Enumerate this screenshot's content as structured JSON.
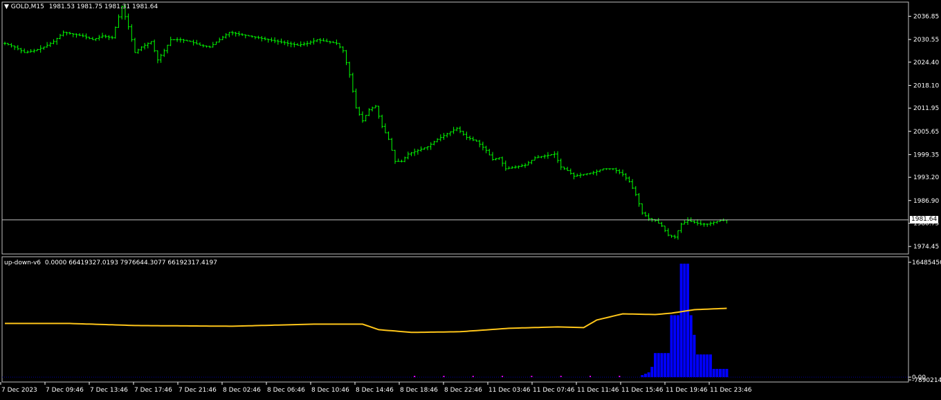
{
  "main_header": {
    "symbol": "GOLD,M15",
    "ohlc": "1981.53 1981.75 1981.31 1981.64"
  },
  "indicator_header": {
    "name": "up-down-v6",
    "values": "0.0000 66419327.0193 7976644.3077 66192317.4197"
  },
  "current_price_label": "1981.64",
  "colors": {
    "background": "#000000",
    "axis": "#ffffff",
    "bars": "#00ff00",
    "price_line": "#c0c0c0",
    "histogram": "#0000ff",
    "signal_line": "#ffc61a",
    "small_marks": "#ff00ff"
  },
  "chart_data": [
    {
      "type": "bar",
      "name": "GOLD,M15 price chart",
      "y_ticks": [
        "2036.85",
        "2030.55",
        "2024.40",
        "2018.10",
        "2011.95",
        "2005.65",
        "1999.35",
        "1993.20",
        "1986.90",
        "1980.75",
        "1974.45"
      ],
      "ylim": [
        1972.6,
        2040.5
      ],
      "current_price": 1981.64,
      "x_labels": [
        "7 Dec 2023",
        "7 Dec 09:46",
        "7 Dec 13:46",
        "7 Dec 17:46",
        "7 Dec 21:46",
        "8 Dec 02:46",
        "8 Dec 06:46",
        "8 Dec 10:46",
        "8 Dec 14:46",
        "8 Dec 18:46",
        "8 Dec 22:46",
        "11 Dec 03:46",
        "11 Dec 07:46",
        "11 Dec 11:46",
        "11 Dec 15:46",
        "11 Dec 19:46",
        "11 Dec 23:46"
      ],
      "close_path": [
        [
          0,
          2029.5
        ],
        [
          3,
          2028.5
        ],
        [
          6,
          2027.0
        ],
        [
          9,
          2027.5
        ],
        [
          12,
          2028.5
        ],
        [
          15,
          2030.0
        ],
        [
          18,
          2032.5
        ],
        [
          21,
          2032.0
        ],
        [
          24,
          2031.5
        ],
        [
          27,
          2030.5
        ],
        [
          30,
          2031.5
        ],
        [
          33,
          2031.0
        ],
        [
          36,
          2039.5
        ],
        [
          38,
          2034.0
        ],
        [
          40,
          2027.0
        ],
        [
          42,
          2028.5
        ],
        [
          45,
          2030.0
        ],
        [
          47,
          2025.0
        ],
        [
          49,
          2027.5
        ],
        [
          51,
          2030.5
        ],
        [
          54,
          2030.5
        ],
        [
          57,
          2030.0
        ],
        [
          60,
          2029.0
        ],
        [
          63,
          2028.5
        ],
        [
          66,
          2030.5
        ],
        [
          69,
          2032.5
        ],
        [
          72,
          2032.0
        ],
        [
          75,
          2031.5
        ],
        [
          78,
          2031.0
        ],
        [
          81,
          2030.5
        ],
        [
          84,
          2030.0
        ],
        [
          87,
          2029.5
        ],
        [
          90,
          2029.0
        ],
        [
          93,
          2029.5
        ],
        [
          96,
          2030.5
        ],
        [
          99,
          2030.0
        ],
        [
          102,
          2029.5
        ],
        [
          104,
          2027.5
        ],
        [
          106,
          2021.0
        ],
        [
          108,
          2012.0
        ],
        [
          110,
          2008.5
        ],
        [
          112,
          2011.5
        ],
        [
          114,
          2012.5
        ],
        [
          116,
          2007.0
        ],
        [
          118,
          2003.5
        ],
        [
          120,
          1997.5
        ],
        [
          122,
          1997.5
        ],
        [
          124,
          1999.5
        ],
        [
          127,
          2000.5
        ],
        [
          130,
          2001.5
        ],
        [
          133,
          2003.5
        ],
        [
          136,
          2005.0
        ],
        [
          139,
          2006.5
        ],
        [
          142,
          2004.0
        ],
        [
          145,
          2003.0
        ],
        [
          148,
          2000.5
        ],
        [
          150,
          1998.0
        ],
        [
          152,
          1998.5
        ],
        [
          154,
          1995.5
        ],
        [
          157,
          1996.0
        ],
        [
          160,
          1996.5
        ],
        [
          163,
          1998.5
        ],
        [
          166,
          1999.0
        ],
        [
          169,
          1999.5
        ],
        [
          171,
          1996.0
        ],
        [
          173,
          1995.0
        ],
        [
          175,
          1993.5
        ],
        [
          178,
          1994.0
        ],
        [
          181,
          1994.5
        ],
        [
          184,
          1995.5
        ],
        [
          187,
          1995.5
        ],
        [
          190,
          1994.0
        ],
        [
          192,
          1992.0
        ],
        [
          194,
          1988.5
        ],
        [
          196,
          1983.5
        ],
        [
          198,
          1982.0
        ],
        [
          200,
          1981.5
        ],
        [
          202,
          1980.0
        ],
        [
          204,
          1977.5
        ],
        [
          206,
          1977.0
        ],
        [
          208,
          1980.5
        ],
        [
          210,
          1981.5
        ],
        [
          212,
          1981.0
        ],
        [
          214,
          1980.5
        ],
        [
          216,
          1980.5
        ],
        [
          218,
          1981.0
        ],
        [
          220,
          1981.5
        ],
        [
          222,
          1981.64
        ]
      ],
      "bar_count": 223
    },
    {
      "type": "bar",
      "name": "up-down-v6",
      "y_ticks": [
        "16485450",
        "0.00",
        "-7890214"
      ],
      "ylim": [
        -7890214,
        16485450
      ],
      "histogram_path": [
        [
          0,
          0
        ],
        [
          195,
          0
        ],
        [
          196,
          300000
        ],
        [
          198,
          700000
        ],
        [
          199,
          1500000
        ],
        [
          200,
          3500000
        ],
        [
          204,
          3500000
        ],
        [
          205,
          9000000
        ],
        [
          207,
          9000000
        ],
        [
          208,
          16485450
        ],
        [
          210,
          16485450
        ],
        [
          211,
          9000000
        ],
        [
          213,
          3300000
        ],
        [
          217,
          3300000
        ],
        [
          218,
          1200000
        ],
        [
          222,
          1200000
        ]
      ],
      "signal_path": [
        [
          0,
          7800000
        ],
        [
          20,
          7800000
        ],
        [
          40,
          7500000
        ],
        [
          70,
          7400000
        ],
        [
          95,
          7700000
        ],
        [
          110,
          7700000
        ],
        [
          115,
          6900000
        ],
        [
          125,
          6500000
        ],
        [
          140,
          6600000
        ],
        [
          155,
          7100000
        ],
        [
          170,
          7300000
        ],
        [
          178,
          7200000
        ],
        [
          182,
          8300000
        ],
        [
          190,
          9200000
        ],
        [
          200,
          9100000
        ],
        [
          205,
          9300000
        ],
        [
          212,
          9800000
        ],
        [
          222,
          10000000
        ]
      ]
    }
  ]
}
